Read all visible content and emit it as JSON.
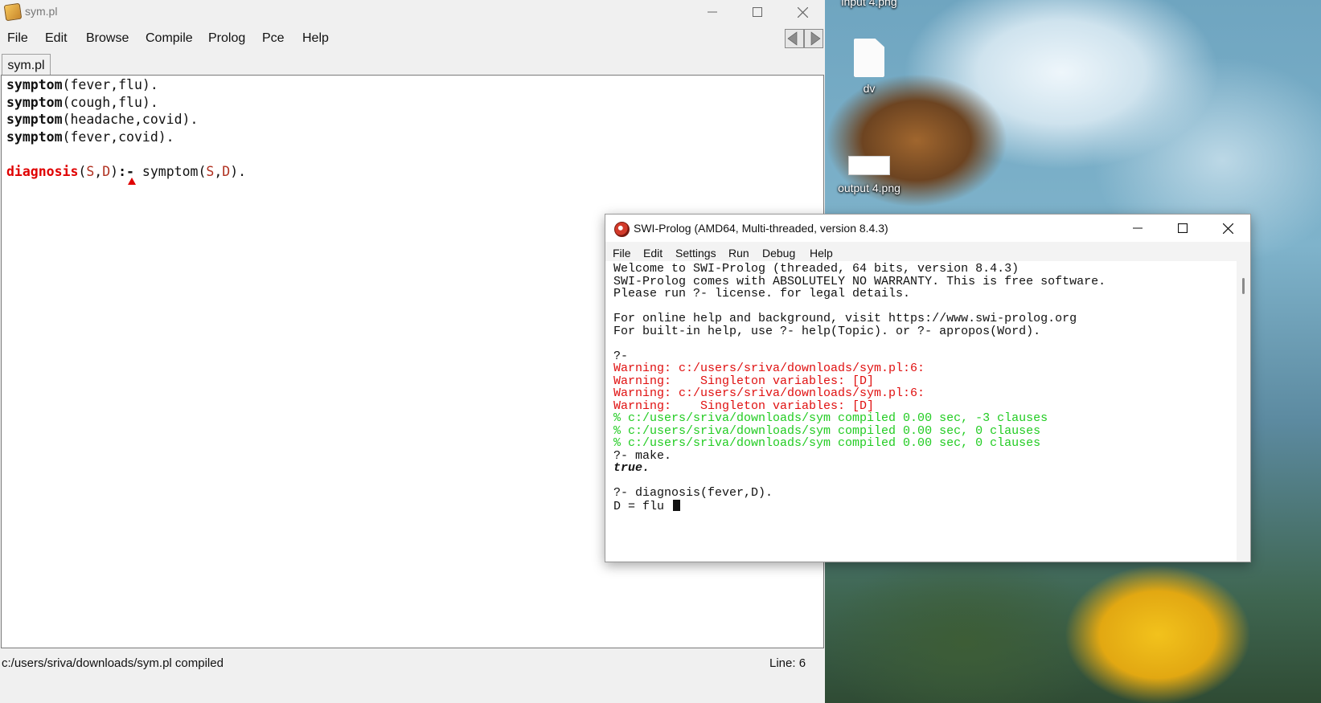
{
  "desktop": {
    "icons": [
      {
        "label": "input 4.png"
      },
      {
        "label": "dv"
      },
      {
        "label": "output 4.png"
      }
    ]
  },
  "editor": {
    "title": "sym.pl",
    "menu": [
      "File",
      "Edit",
      "Browse",
      "Compile",
      "Prolog",
      "Pce",
      "Help"
    ],
    "tab": "sym.pl",
    "code": [
      {
        "head": "symptom",
        "rest": "(fever,flu)."
      },
      {
        "head": "symptom",
        "rest": "(cough,flu)."
      },
      {
        "head": "symptom",
        "rest": "(headache,covid)."
      },
      {
        "head": "symptom",
        "rest": "(fever,covid)."
      }
    ],
    "rule": {
      "head": "diagnosis",
      "open": "(",
      "v1": "S",
      "comma": ",",
      "v2": "D",
      "close": ")",
      "neck": ":-",
      "body": " symptom(",
      "bv1": "S",
      "bcomma": ",",
      "bv2": "D",
      "end": ")."
    },
    "status_left": "c:/users/sriva/downloads/sym.pl compiled",
    "status_right": "Line: 6"
  },
  "console": {
    "title": "SWI-Prolog (AMD64, Multi-threaded, version 8.4.3)",
    "menu": [
      "File",
      "Edit",
      "Settings",
      "Run",
      "Debug",
      "Help"
    ],
    "lines": [
      {
        "text": "Welcome to SWI-Prolog (threaded, 64 bits, version 8.4.3)",
        "style": "black"
      },
      {
        "text": "SWI-Prolog comes with ABSOLUTELY NO WARRANTY. This is free software.",
        "style": "black"
      },
      {
        "text": "Please run ?- license. for legal details.",
        "style": "black"
      },
      {
        "text": "",
        "style": "black"
      },
      {
        "text": "For online help and background, visit https://www.swi-prolog.org",
        "style": "black"
      },
      {
        "text": "For built-in help, use ?- help(Topic). or ?- apropos(Word).",
        "style": "black"
      },
      {
        "text": "",
        "style": "black"
      },
      {
        "text": "?-",
        "style": "black"
      },
      {
        "text": "Warning: c:/users/sriva/downloads/sym.pl:6:",
        "style": "red"
      },
      {
        "text": "Warning:    Singleton variables: [D]",
        "style": "red"
      },
      {
        "text": "Warning: c:/users/sriva/downloads/sym.pl:6:",
        "style": "red"
      },
      {
        "text": "Warning:    Singleton variables: [D]",
        "style": "red"
      },
      {
        "text": "% c:/users/sriva/downloads/sym compiled 0.00 sec, -3 clauses",
        "style": "green"
      },
      {
        "text": "% c:/users/sriva/downloads/sym compiled 0.00 sec, 0 clauses",
        "style": "green"
      },
      {
        "text": "% c:/users/sriva/downloads/sym compiled 0.00 sec, 0 clauses",
        "style": "green"
      },
      {
        "text": "?- make.",
        "style": "black"
      },
      {
        "text": "true.",
        "style": "bold"
      },
      {
        "text": "",
        "style": "black"
      },
      {
        "text": "?- diagnosis(fever,D).",
        "style": "black"
      },
      {
        "text": "D = flu ",
        "style": "cursor"
      }
    ]
  }
}
